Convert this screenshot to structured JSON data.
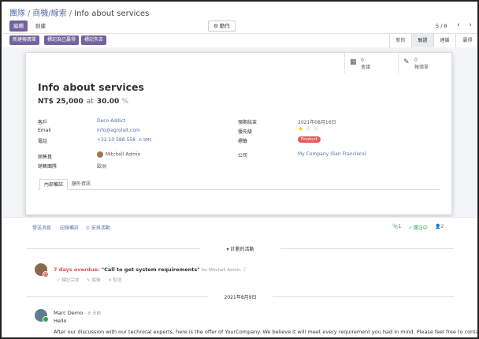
{
  "breadcrumb": {
    "root": "團隊",
    "middle": "商機/線索",
    "current": "Info about services",
    "sep": "/"
  },
  "toolbar": {
    "edit_label": "編輯",
    "create_label": "創建",
    "action_label": "⚙ 動作",
    "pager": "5 / 8",
    "prev_icon": "‹",
    "next_icon": "›"
  },
  "statusbar": {
    "buttons": [
      "新建報價單",
      "標記為已贏得",
      "標記失去"
    ],
    "stages": [
      "新的",
      "驗證",
      "建議",
      "贏得"
    ],
    "active_stage": "驗證"
  },
  "smart_buttons": [
    {
      "icon": "calendar-icon",
      "count": "0",
      "label": "會議"
    },
    {
      "icon": "edit-icon",
      "count": "0",
      "label": "報價單"
    }
  ],
  "record": {
    "title": "Info about services",
    "revenue": "NT$ 25,000",
    "at": "at",
    "probability": "30.00",
    "pct": "%"
  },
  "fields": {
    "customer_label": "客戶",
    "customer": "Deco Addict",
    "email_label": "Email",
    "email": "info@agrolait.com",
    "phone_label": "電話",
    "phone": "+32 10 588 558",
    "sms": "✆ SMS",
    "salesperson_label": "銷售員",
    "salesperson": "Mitchell Admin",
    "team_label": "銷售團隊",
    "team": "歐洲",
    "deadline_label": "預期結束",
    "deadline": "2021年08月16日",
    "priority_label": "優先級",
    "priority_stars": 1,
    "priority_max": 3,
    "tags_label": "標籤",
    "tag": "Product",
    "company_label": "公司",
    "company": "My Company (San Francisco)"
  },
  "tabs": [
    "內部備註",
    "額外資訊"
  ],
  "chatter": {
    "send_message": "發送消息",
    "log_note": "記錄備註",
    "schedule_activity": "⊙ 安排活動",
    "attachments": "📎1",
    "following": "✓ 關注中",
    "followers": "👤2",
    "planned_activities": "▾ 計劃的活動",
    "activity": {
      "overdue": "7 days overdue:",
      "summary": "\"Call to get system requirements\"",
      "for_user": "for Mitchell Admin",
      "info_icon": "ⓘ",
      "actions": [
        "✓ 標記完成",
        "✎ 編輯",
        "✕ 取消"
      ]
    },
    "date_divider": "2021年8月9日",
    "message": {
      "author": "Marc Demo",
      "ago": "- 8 天前",
      "greeting": "Hello",
      "body": "After our discussion with our technical experts, here is the offer of YourCompany. We believe it will meet every requirement you had in mind. Please feel free to contact me for any"
    }
  },
  "colors": {
    "primary": "#71639e",
    "link": "#5a6fa8",
    "danger": "#e05c5c",
    "success": "#28a745",
    "star": "#f3cc00"
  }
}
